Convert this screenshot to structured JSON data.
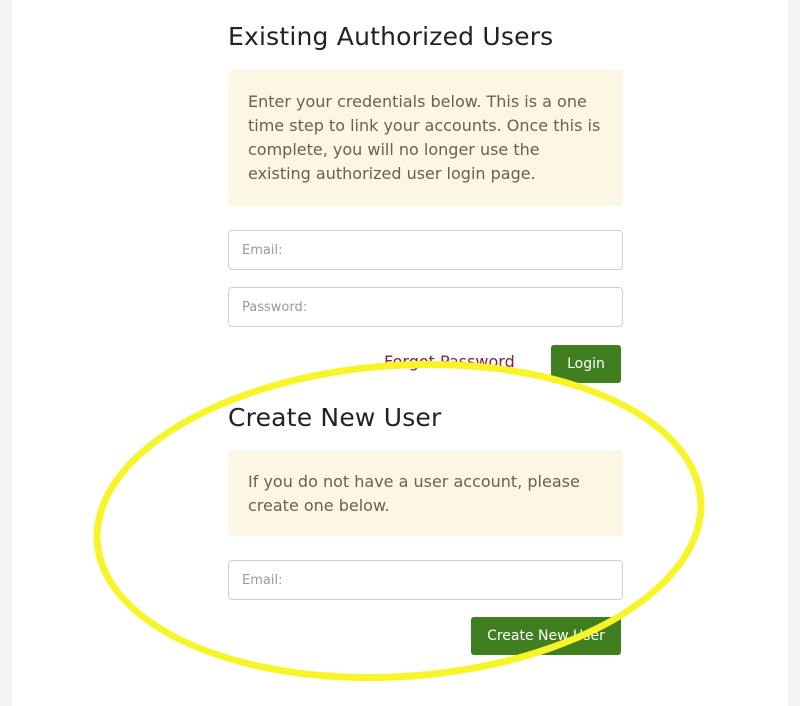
{
  "existing": {
    "title": "Existing Authorized Users",
    "notice": "Enter your credentials below. This is a one time step to link your accounts. Once this is complete, you will no longer use the existing authorized user login page.",
    "email_placeholder": "Email:",
    "password_placeholder": "Password:",
    "forgot_label": "Forgot Password",
    "login_label": "Login"
  },
  "create": {
    "title": "Create New User",
    "notice": "If you do not have a user account, please create one below.",
    "email_placeholder": "Email:",
    "button_label": "Create New User"
  },
  "colors": {
    "accent_button": "#3f7f1f",
    "notice_background": "#fcf6e5",
    "link": "#8a1d37",
    "highlight": "#f7f42a"
  }
}
